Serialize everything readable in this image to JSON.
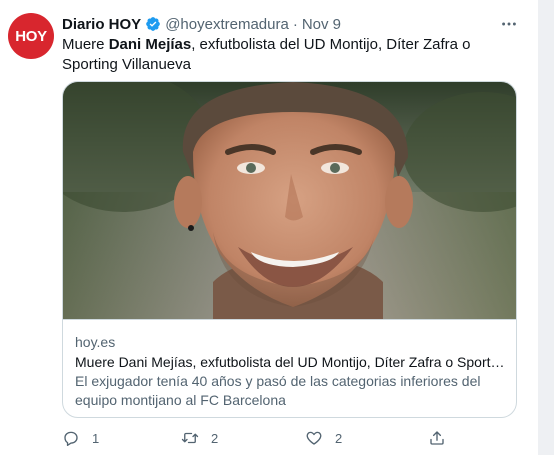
{
  "account": {
    "avatar_text": "HOY",
    "name": "Diario HOY",
    "handle": "@hoyextremadura",
    "separator": "·",
    "date": "Nov 9"
  },
  "tweet": {
    "text_before": "Muere ",
    "text_bold": "Dani Mejías",
    "text_after": ", exfutbolista del UD Montijo, Díter Zafra o Sporting Villanueva"
  },
  "card": {
    "domain": "hoy.es",
    "title": "Muere Dani Mejías, exfutbolista del UD Montijo, Díter Zafra o Sporting Villanueva",
    "description": "El exjugador tenía 40 años y pasó de las categorias inferiores del equipo montijano al FC Barcelona"
  },
  "actions": {
    "replies": "1",
    "retweets": "2",
    "likes": "2"
  },
  "icons": {
    "verified": "verified-badge-icon",
    "more": "more-dots-icon",
    "reply": "reply-icon",
    "retweet": "retweet-icon",
    "like": "heart-icon",
    "share": "share-icon"
  },
  "colors": {
    "avatar_bg": "#d8262e",
    "verified": "#1d9bf0",
    "secondary_text": "#536471",
    "border": "#cfd9de"
  }
}
